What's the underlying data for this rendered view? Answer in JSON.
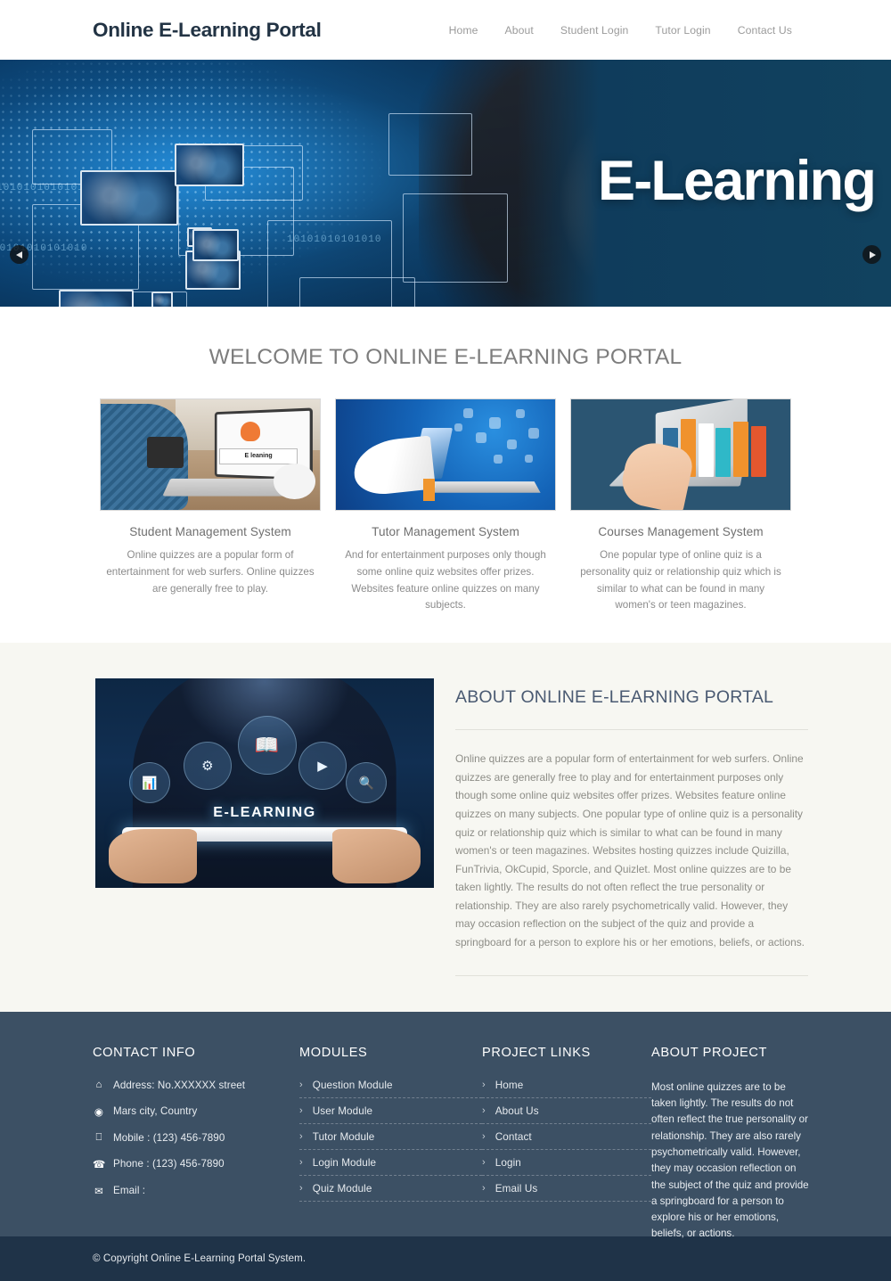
{
  "header": {
    "brand": "Online E-Learning Portal",
    "nav": [
      {
        "label": "Home"
      },
      {
        "label": "About"
      },
      {
        "label": "Student Login"
      },
      {
        "label": "Tutor Login"
      },
      {
        "label": "Contact Us"
      }
    ]
  },
  "hero": {
    "title": "E-Learning",
    "prev_icon": "chevron-left-icon",
    "next_icon": "chevron-right-icon",
    "overlay_text": "10101010101010",
    "background_color": "#10425f"
  },
  "welcome": {
    "heading": "WELCOME TO ONLINE E-LEARNING PORTAL",
    "cards": [
      {
        "title": "Student Management System",
        "text": "Online quizzes are a popular form of entertainment for web surfers. Online quizzes are generally free to play.",
        "image_label": "E leaning"
      },
      {
        "title": "Tutor Management System",
        "text": "And for entertainment purposes only though some online quiz websites offer prizes. Websites feature online quizzes on many subjects.",
        "image_label": ""
      },
      {
        "title": "Courses Management System",
        "text": "One popular type of online quiz is a personality quiz or relationship quiz which is similar to what can be found in many women's or teen magazines.",
        "image_label": ""
      }
    ]
  },
  "about": {
    "heading": "ABOUT ONLINE E-LEARNING PORTAL",
    "image_label": "E-LEARNING",
    "text": "Online quizzes are a popular form of entertainment for web surfers. Online quizzes are generally free to play and for entertainment purposes only though some online quiz websites offer prizes. Websites feature online quizzes on many subjects. One popular type of online quiz is a personality quiz or relationship quiz which is similar to what can be found in many women's or teen magazines. Websites hosting quizzes include Quizilla, FunTrivia, OkCupid, Sporcle, and Quizlet. Most online quizzes are to be taken lightly. The results do not often reflect the true personality or relationship. They are also rarely psychometrically valid. However, they may occasion reflection on the subject of the quiz and provide a springboard for a person to explore his or her emotions, beliefs, or actions."
  },
  "footer": {
    "contact": {
      "heading": "CONTACT INFO",
      "rows": [
        {
          "icon": "home-icon",
          "glyph": "⌂",
          "text": "Address: No.XXXXXX street"
        },
        {
          "icon": "globe-icon",
          "glyph": "◉",
          "text": "Mars city, Country"
        },
        {
          "icon": "mobile-icon",
          "glyph": "⎕",
          "text": "Mobile : (123) 456-7890"
        },
        {
          "icon": "phone-icon",
          "glyph": "☎",
          "text": "Phone : (123) 456-7890"
        },
        {
          "icon": "envelope-icon",
          "glyph": "✉",
          "text": "Email :"
        }
      ]
    },
    "modules": {
      "heading": "MODULES",
      "links": [
        {
          "label": "Question Module"
        },
        {
          "label": "User Module"
        },
        {
          "label": "Tutor Module"
        },
        {
          "label": "Login Module"
        },
        {
          "label": "Quiz Module"
        }
      ]
    },
    "project_links": {
      "heading": "PROJECT LINKS",
      "links": [
        {
          "label": "Home"
        },
        {
          "label": "About Us"
        },
        {
          "label": "Contact"
        },
        {
          "label": "Login"
        },
        {
          "label": "Email Us"
        }
      ]
    },
    "about_project": {
      "heading": "ABOUT PROJECT",
      "text": "Most online quizzes are to be taken lightly. The results do not often reflect the true personality or relationship. They are also rarely psychometrically valid. However, they may occasion reflection on the subject of the quiz and provide a springboard for a person to explore his or her emotions, beliefs, or actions."
    },
    "copyright": "© Copyright Online E-Learning Portal System."
  },
  "colors": {
    "footer_bg": "#3c5064",
    "copyright_bg": "#1f3348",
    "about_bg": "#f7f7f2",
    "heading": "#7d7d7d",
    "about_heading": "#4a5a72"
  }
}
